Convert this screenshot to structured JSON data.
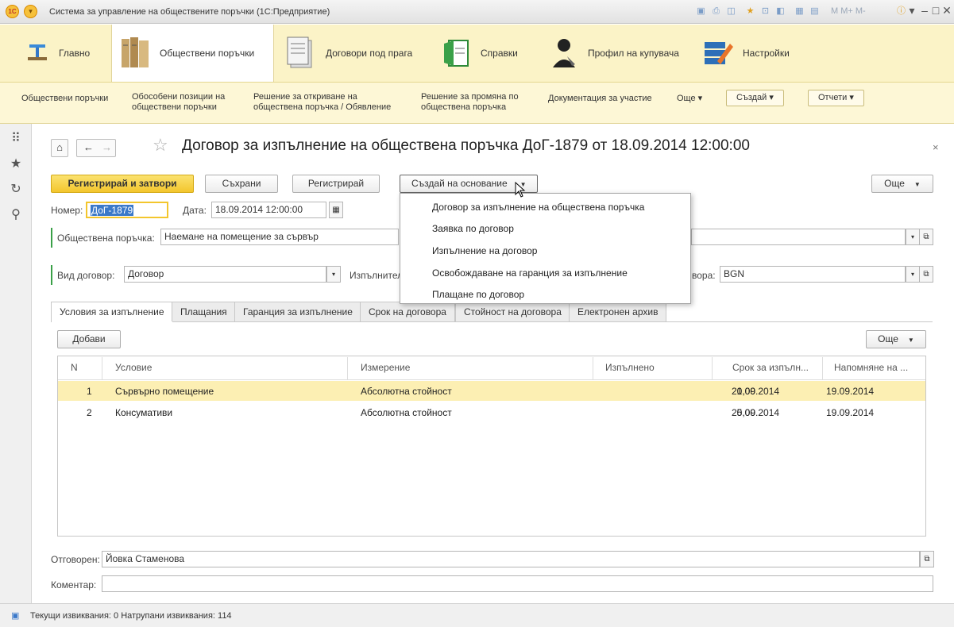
{
  "window": {
    "title": "Система за управление на обществените поръчки (1С:Предприятие)",
    "toolbar_text": "M  M+  M-"
  },
  "nav": [
    {
      "label": "Главно"
    },
    {
      "label": "Обществени поръчки"
    },
    {
      "label": "Договори под прага"
    },
    {
      "label": "Справки"
    },
    {
      "label": "Профил на купувача"
    },
    {
      "label": "Настройки"
    }
  ],
  "subnav": {
    "l1": "Обществени поръчки",
    "l2a": "Обособени позиции на",
    "l2b": "обществени поръчки",
    "l3a": "Решение за откриване на",
    "l3b": "обществена поръчка / Обявление",
    "l4a": "Решение за промяна по",
    "l4b": "обществена поръчка",
    "l5": "Документация за участие",
    "more": "Още ▾",
    "create": "Създай ▾",
    "reports": "Отчети ▾"
  },
  "doc": {
    "title": "Договор за изпълнение на обществена поръчка ДоГ-1879 от 18.09.2014 12:00:00"
  },
  "toolbar": {
    "register_close": "Регистрирай и затвори",
    "save": "Съхрани",
    "register": "Регистрирай",
    "create_base": "Създай на основание",
    "more": "Още"
  },
  "form": {
    "number_label": "Номер:",
    "number": "ДоГ-1879",
    "date_label": "Дата:",
    "date": "18.09.2014 12:00:00",
    "proc_label": "Обществена поръчка:",
    "proc_value": "Наемане на помещение за сървър",
    "type_label": "Вид договор:",
    "type_value": "Договор",
    "executor_label": "Изпълнител",
    "currency_label": "вора:",
    "currency_value": "BGN"
  },
  "menu": {
    "i1": "Договор за изпълнение на обществена поръчка",
    "i2": "Заявка по договор",
    "i3": "Изпълнение на договор",
    "i4": "Освобождаване на гаранция за изпълнение",
    "i5": "Плащане по договор"
  },
  "tabs": {
    "t1": "Условия за изпълнение",
    "t2": "Плащания",
    "t3": "Гаранция за изпълнение",
    "t4": "Срок на договора",
    "t5": "Стойност на договора",
    "t6": "Електронен архив"
  },
  "table": {
    "add": "Добави",
    "more": "Още",
    "cols": {
      "n": "N",
      "cond": "Условие",
      "meas": "Измерение",
      "done": "Изпълнено",
      "term": "Срок за изпълн...",
      "remind": "Напомняне на ..."
    },
    "rows": [
      {
        "n": "1",
        "cond": "Сървърно помещение",
        "meas": "Абсолютна стойност",
        "done": "1,00",
        "term": "20.09.2014",
        "remind": "19.09.2014"
      },
      {
        "n": "2",
        "cond": "Консумативи",
        "meas": "Абсолютна стойност",
        "done": "5,00",
        "term": "20.09.2014",
        "remind": "19.09.2014"
      }
    ]
  },
  "footer": {
    "resp_label": "Отговорен:",
    "resp_value": "Йовка Стаменова",
    "comment_label": "Коментар:",
    "comment_value": ""
  },
  "status": {
    "text": "Текущи извиквания: 0   Натрупани извиквания: 114"
  },
  "colors": {
    "accent": "#f3c62d",
    "nav_bg": "#fbf3c7",
    "selected_row": "#fcefb3"
  }
}
